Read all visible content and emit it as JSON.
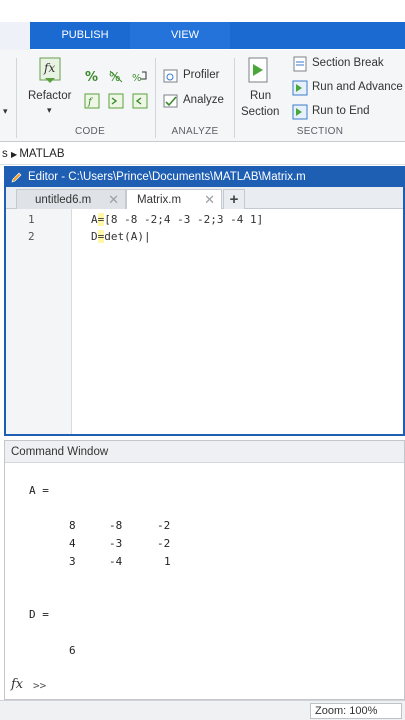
{
  "tabs": {
    "publish": "PUBLISH",
    "view": "VIEW"
  },
  "ribbon": {
    "code": {
      "refactor_label": "Refactor",
      "group_label": "CODE"
    },
    "analyze": {
      "profiler_label": "Profiler",
      "analyze_label": "Analyze",
      "group_label": "ANALYZE"
    },
    "section": {
      "run_section_line1": "Run",
      "run_section_line2": "Section",
      "section_break_label": "Section Break",
      "run_advance_label": "Run and Advance",
      "run_to_end_label": "Run to End",
      "group_label": "SECTION"
    }
  },
  "breadcrumb": {
    "prefix": "s",
    "current": "MATLAB"
  },
  "editor": {
    "title": "Editor - C:\\Users\\Prince\\Documents\\MATLAB\\Matrix.m",
    "tabs": [
      {
        "label": "untitled6.m"
      },
      {
        "label": "Matrix.m"
      }
    ],
    "add_tab": "+",
    "lines": [
      {
        "num": "1",
        "pre": "A",
        "hl": "=",
        "post": "[8 -8 -2;4 -3 -2;3 -4 1]"
      },
      {
        "num": "2",
        "pre": "D",
        "hl": "=",
        "post": "det(A)|"
      }
    ]
  },
  "command_window": {
    "title": "Command Window",
    "a_label": "A =",
    "matrix": [
      [
        "8",
        "-8",
        "-2"
      ],
      [
        "4",
        "-3",
        "-2"
      ],
      [
        "3",
        "-4",
        "1"
      ]
    ],
    "d_label": "D =",
    "d_value": "6",
    "prompt_fx": "fx",
    "prompt": ">>"
  },
  "status": {
    "zoom": "Zoom: 100%"
  },
  "colors": {
    "accent": "#1b6ad2",
    "editor_border": "#1e5fb4"
  }
}
